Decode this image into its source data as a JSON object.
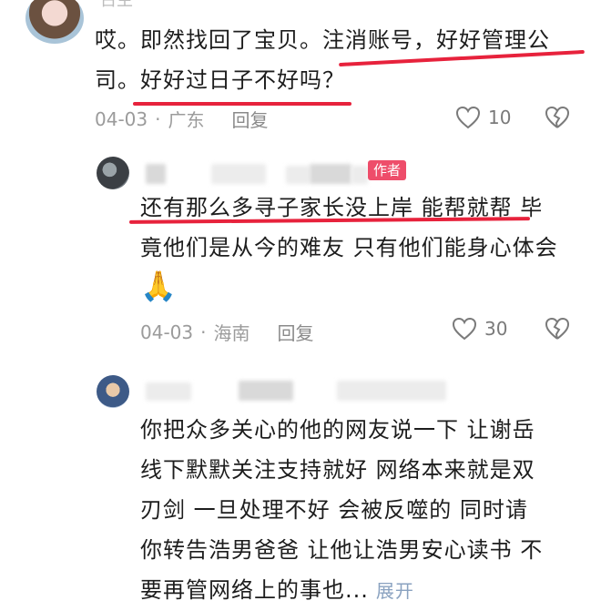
{
  "comments": [
    {
      "author_partial": "古主",
      "lines": [
        "哎。即然找回了宝贝。注消账号，好好管理公",
        "司。好好过日子不好吗？"
      ],
      "date": "04-03",
      "location": "广东",
      "reply_label": "回复",
      "likes": "10"
    },
    {
      "author_tag": "作者",
      "lines": [
        "还有那么多寻子家长没上岸 能帮就帮 毕",
        "竟他们是从今的难友 只有他们能身心体会"
      ],
      "emoji": "🙏",
      "date": "04-03",
      "location": "海南",
      "reply_label": "回复",
      "likes": "30"
    },
    {
      "lines": [
        "你把众多关心的他的网友说一下  让谢岳",
        "线下默默关注支持就好  网络本来就是双",
        "刃剑  一旦处理不好 会被反噬的   同时请",
        "你转告浩男爸爸 让他让浩男安心读书  不",
        "要再管网络上的事也..."
      ],
      "expand_label": "展开"
    }
  ],
  "separator": "·",
  "colors": {
    "highlight": "#e7223c",
    "author_tag": "#ee4d6a"
  },
  "icons": [
    "heart-icon",
    "broken-heart-icon"
  ]
}
